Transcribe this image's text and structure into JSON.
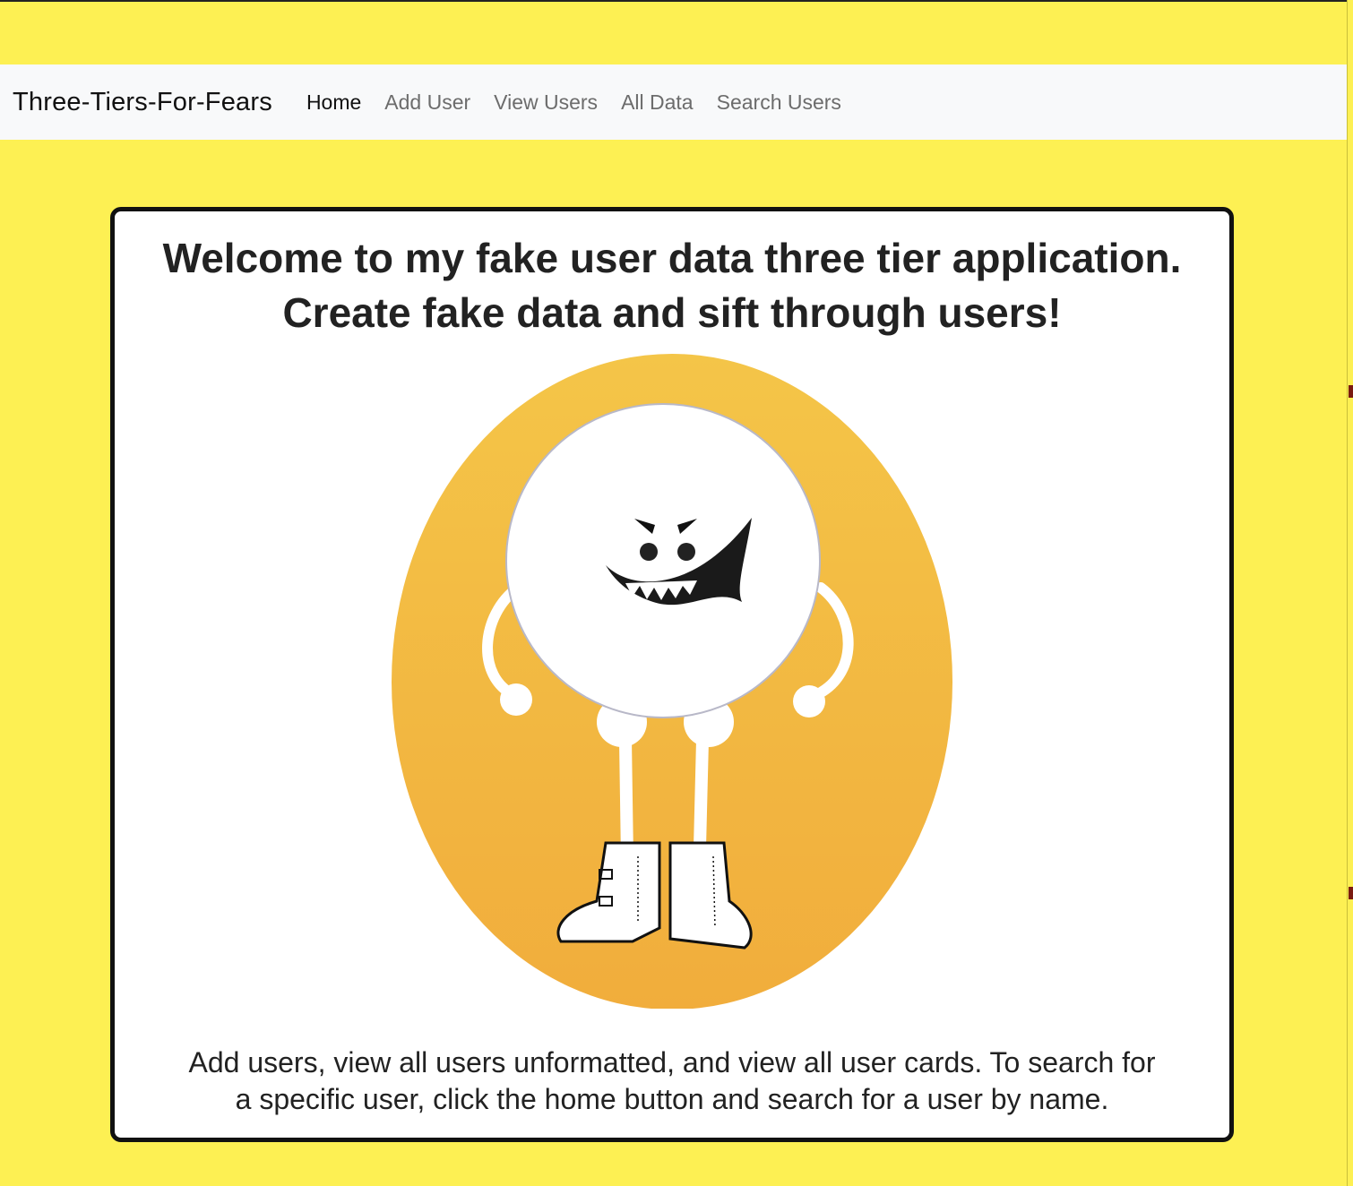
{
  "navbar": {
    "brand": "Three-Tiers-For-Fears",
    "links": [
      {
        "label": "Home",
        "active": true
      },
      {
        "label": "Add User",
        "active": false
      },
      {
        "label": "View Users",
        "active": false
      },
      {
        "label": "All Data",
        "active": false
      },
      {
        "label": "Search Users",
        "active": false
      }
    ]
  },
  "main": {
    "headline_line1": "Welcome to my fake user data three tier application.",
    "headline_line2": "Create fake data and sift through users!",
    "description_line1": "Add users, view all users unformatted, and view all user cards. To search for",
    "description_line2": "a specific user, click the home button and search for a user by name."
  },
  "colors": {
    "page_background": "#fdf053",
    "navbar_background": "#f8f9fa",
    "card_background": "#ffffff",
    "card_border": "#111111",
    "oval_top": "#f4c548",
    "oval_bottom": "#f1ad3c"
  },
  "illustration": {
    "icon": "grinning-ball-monster-icon"
  }
}
